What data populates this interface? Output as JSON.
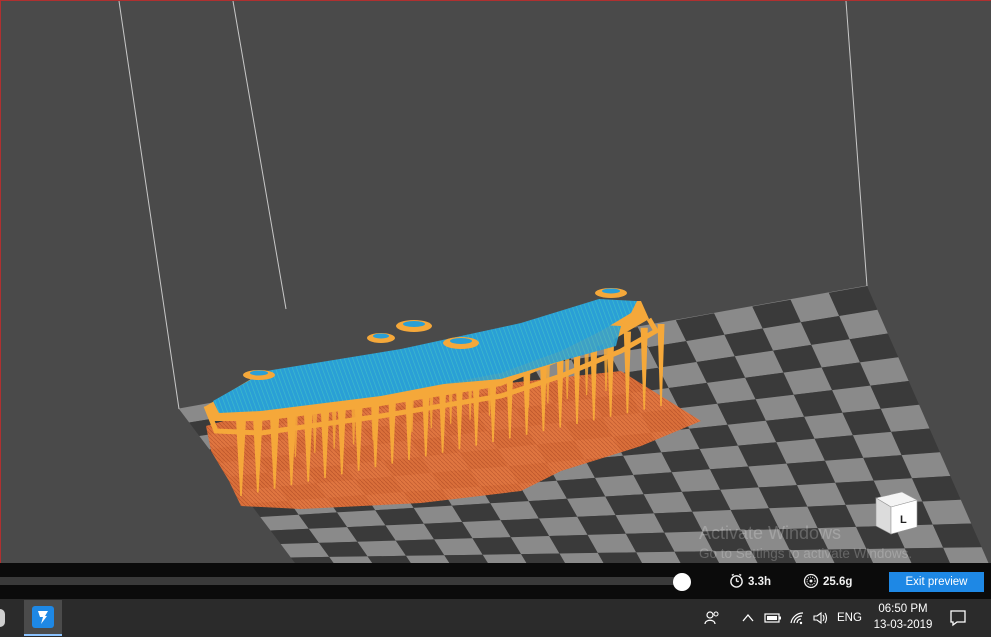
{
  "viewport": {
    "watermark_title": "Activate Windows",
    "watermark_subtitle": "Go to Settings to activate Windows.",
    "view_cube_label": "L",
    "colors": {
      "background": "#4a4a4a",
      "model_infill": "#2aa8d8",
      "supports": "#f5a83a",
      "raft": "#e8743a",
      "bed_light": "#8a8a8a",
      "bed_dark": "#3a3a3a"
    }
  },
  "preview_bar": {
    "layer_position": 1.0,
    "print_time": "3.3h",
    "print_time_icon": "clock-icon",
    "filament_weight": "25.6g",
    "filament_icon": "spool-icon",
    "exit_label": "Exit preview"
  },
  "taskbar": {
    "app_icon": "slicer-app-icon",
    "tray_icons": [
      "people-icon",
      "chevron-up-icon",
      "battery-icon",
      "wifi-icon",
      "volume-icon"
    ],
    "language": "ENG",
    "time": "06:50 PM",
    "date": "13-03-2019",
    "notification_icon": "notification-icon"
  }
}
